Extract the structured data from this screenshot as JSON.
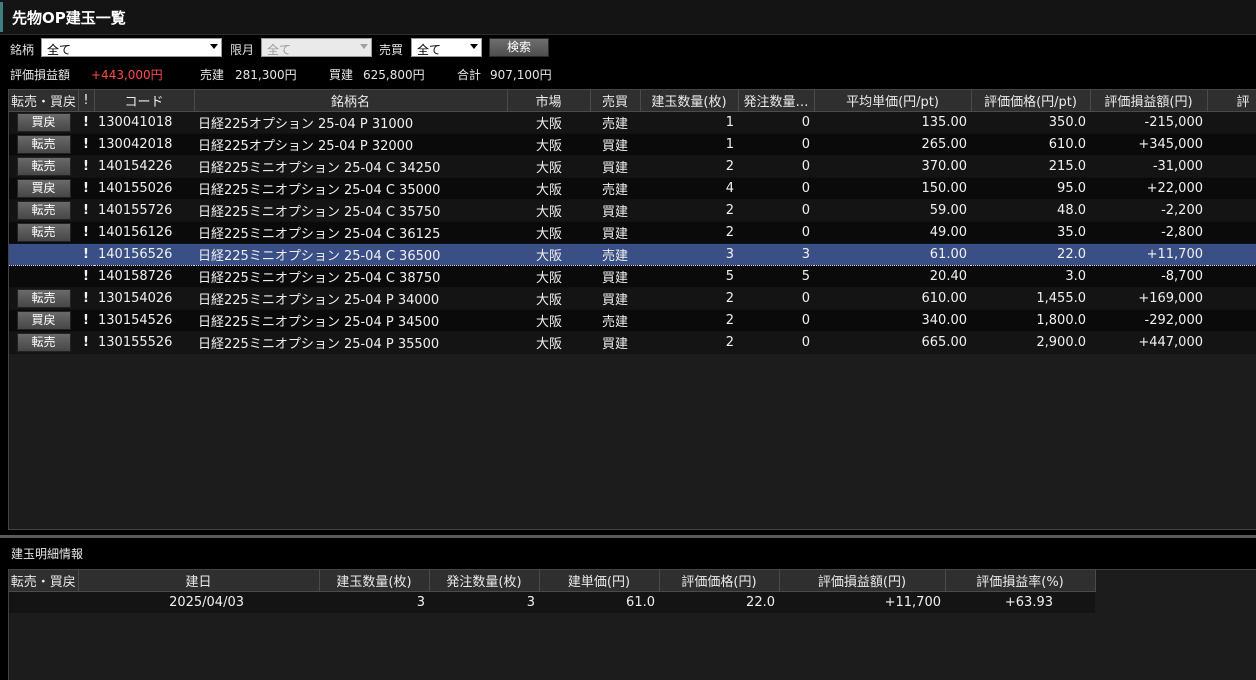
{
  "window": {
    "title": "先物OP建玉一覧"
  },
  "filters": {
    "symbol_label": "銘柄",
    "symbol_value": "全て",
    "month_label": "限月",
    "month_value": "全て",
    "side_label": "売買",
    "side_value": "全て",
    "search_button": "検索"
  },
  "summary": {
    "pl_label": "評価損益額",
    "pl_value": "+443,000円",
    "sell_label": "売建",
    "sell_value": "281,300円",
    "buy_label": "買建",
    "buy_value": "625,800円",
    "total_label": "合計",
    "total_value": "907,100円"
  },
  "positions": {
    "columns": [
      "転売・買戻",
      "!",
      "コード",
      "銘柄名",
      "市場",
      "売買",
      "建玉数量(枚)",
      "発注数量…",
      "平均単価(円/pt)",
      "評価価格(円/pt)",
      "評価損益額(円)",
      "評"
    ],
    "rows": [
      {
        "action": "買戻",
        "mark": "!",
        "code": "130041018",
        "name": "日経225オプション 25-04 P 31000",
        "market": "大阪",
        "side": "売建",
        "qty": "1",
        "order_qty": "0",
        "avg_price": "135.00",
        "eval_price": "350.0",
        "pl": "-215,000",
        "pl_sign": "neg",
        "side_type": "sell"
      },
      {
        "action": "転売",
        "mark": "!",
        "code": "130042018",
        "name": "日経225オプション 25-04 P 32000",
        "market": "大阪",
        "side": "買建",
        "qty": "1",
        "order_qty": "0",
        "avg_price": "265.00",
        "eval_price": "610.0",
        "pl": "+345,000",
        "pl_sign": "pos",
        "side_type": "buy"
      },
      {
        "action": "転売",
        "mark": "!",
        "code": "140154226",
        "name": "日経225ミニオプション 25-04 C 34250",
        "market": "大阪",
        "side": "買建",
        "qty": "2",
        "order_qty": "0",
        "avg_price": "370.00",
        "eval_price": "215.0",
        "pl": "-31,000",
        "pl_sign": "neg",
        "side_type": "buy"
      },
      {
        "action": "買戻",
        "mark": "!",
        "code": "140155026",
        "name": "日経225ミニオプション 25-04 C 35000",
        "market": "大阪",
        "side": "売建",
        "qty": "4",
        "order_qty": "0",
        "avg_price": "150.00",
        "eval_price": "95.0",
        "pl": "+22,000",
        "pl_sign": "pos",
        "side_type": "sell"
      },
      {
        "action": "転売",
        "mark": "!",
        "code": "140155726",
        "name": "日経225ミニオプション 25-04 C 35750",
        "market": "大阪",
        "side": "買建",
        "qty": "2",
        "order_qty": "0",
        "avg_price": "59.00",
        "eval_price": "48.0",
        "pl": "-2,200",
        "pl_sign": "neg",
        "side_type": "buy"
      },
      {
        "action": "転売",
        "mark": "!",
        "code": "140156126",
        "name": "日経225ミニオプション 25-04 C 36125",
        "market": "大阪",
        "side": "買建",
        "qty": "2",
        "order_qty": "0",
        "avg_price": "49.00",
        "eval_price": "35.0",
        "pl": "-2,800",
        "pl_sign": "neg",
        "side_type": "buy"
      },
      {
        "action": "",
        "mark": "!",
        "code": "140156526",
        "name": "日経225ミニオプション 25-04 C 36500",
        "market": "大阪",
        "side": "売建",
        "qty": "3",
        "order_qty": "3",
        "avg_price": "61.00",
        "eval_price": "22.0",
        "pl": "+11,700",
        "pl_sign": "pos",
        "side_type": "sell",
        "selected": true
      },
      {
        "action": "",
        "mark": "!",
        "code": "140158726",
        "name": "日経225ミニオプション 25-04 C 38750",
        "market": "大阪",
        "side": "買建",
        "qty": "5",
        "order_qty": "5",
        "avg_price": "20.40",
        "eval_price": "3.0",
        "pl": "-8,700",
        "pl_sign": "neg",
        "side_type": "buy"
      },
      {
        "action": "転売",
        "mark": "!",
        "code": "130154026",
        "name": "日経225ミニオプション 25-04 P 34000",
        "market": "大阪",
        "side": "買建",
        "qty": "2",
        "order_qty": "0",
        "avg_price": "610.00",
        "eval_price": "1,455.0",
        "pl": "+169,000",
        "pl_sign": "pos",
        "side_type": "buy"
      },
      {
        "action": "買戻",
        "mark": "!",
        "code": "130154526",
        "name": "日経225ミニオプション 25-04 P 34500",
        "market": "大阪",
        "side": "売建",
        "qty": "2",
        "order_qty": "0",
        "avg_price": "340.00",
        "eval_price": "1,800.0",
        "pl": "-292,000",
        "pl_sign": "neg",
        "side_type": "sell"
      },
      {
        "action": "転売",
        "mark": "!",
        "code": "130155526",
        "name": "日経225ミニオプション 25-04 P 35500",
        "market": "大阪",
        "side": "買建",
        "qty": "2",
        "order_qty": "0",
        "avg_price": "665.00",
        "eval_price": "2,900.0",
        "pl": "+447,000",
        "pl_sign": "pos",
        "side_type": "buy"
      }
    ]
  },
  "detail": {
    "title": "建玉明細情報",
    "columns": [
      "転売・買戻",
      "建日",
      "建玉数量(枚)",
      "発注数量(枚)",
      "建単価(円)",
      "評価価格(円)",
      "評価損益額(円)",
      "評価損益率(%)"
    ],
    "row": {
      "action": "",
      "date": "2025/04/03",
      "qty": "3",
      "order_qty": "3",
      "price": "61.0",
      "eval_price": "22.0",
      "pl": "+11,700",
      "pl_rate": "+63.93"
    }
  },
  "colors": {
    "negative": "#35d835",
    "positive": "#ff4b4b",
    "sell": "#30d6b5",
    "buy": "#e040c8",
    "selected_row": "#3a4f86"
  }
}
